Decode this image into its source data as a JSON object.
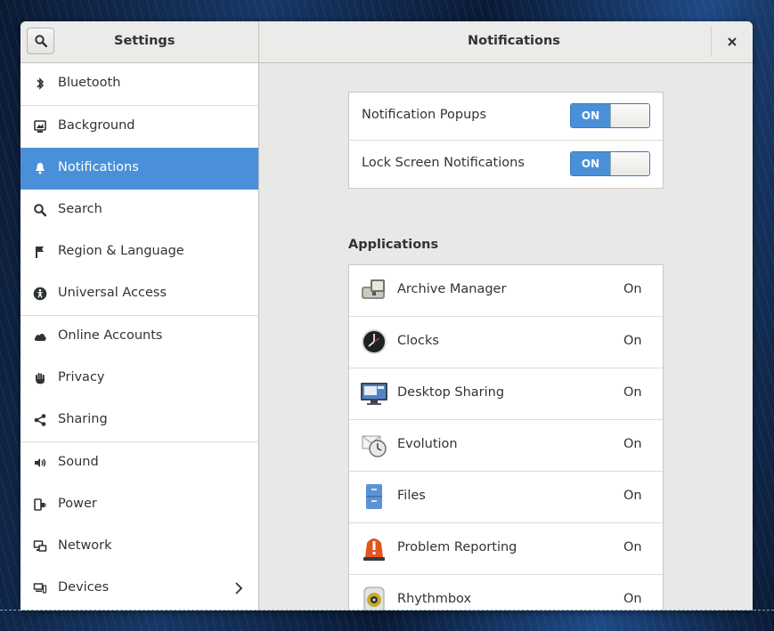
{
  "header": {
    "settings_title": "Settings",
    "panel_title": "Notifications"
  },
  "sidebar": {
    "items": [
      {
        "label": "Bluetooth",
        "icon": "bluetooth-icon"
      },
      {
        "label": "Background",
        "icon": "background-icon"
      },
      {
        "label": "Notifications",
        "icon": "bell-icon",
        "active": true
      },
      {
        "label": "Search",
        "icon": "search-icon"
      },
      {
        "label": "Region & Language",
        "icon": "flag-icon"
      },
      {
        "label": "Universal Access",
        "icon": "accessibility-icon"
      },
      {
        "label": "Online Accounts",
        "icon": "cloud-icon"
      },
      {
        "label": "Privacy",
        "icon": "hand-icon"
      },
      {
        "label": "Sharing",
        "icon": "share-icon"
      },
      {
        "label": "Sound",
        "icon": "speaker-icon"
      },
      {
        "label": "Power",
        "icon": "power-plug-icon"
      },
      {
        "label": "Network",
        "icon": "network-icon"
      },
      {
        "label": "Devices",
        "icon": "devices-icon"
      }
    ]
  },
  "main": {
    "toggles": [
      {
        "label": "Notification Popups",
        "state": "ON"
      },
      {
        "label": "Lock Screen Notifications",
        "state": "ON"
      }
    ],
    "applications_heading": "Applications",
    "applications": [
      {
        "name": "Archive Manager",
        "state": "On",
        "icon": "archive-manager-icon"
      },
      {
        "name": "Clocks",
        "state": "On",
        "icon": "clocks-icon"
      },
      {
        "name": "Desktop Sharing",
        "state": "On",
        "icon": "desktop-sharing-icon"
      },
      {
        "name": "Evolution",
        "state": "On",
        "icon": "evolution-icon"
      },
      {
        "name": "Files",
        "state": "On",
        "icon": "files-icon"
      },
      {
        "name": "Problem Reporting",
        "state": "On",
        "icon": "problem-reporting-icon"
      },
      {
        "name": "Rhythmbox",
        "state": "On",
        "icon": "rhythmbox-icon"
      }
    ]
  },
  "colors": {
    "accent": "#4a90d9",
    "sidebar_bg": "#ffffff",
    "content_bg": "#e8e8e7"
  }
}
